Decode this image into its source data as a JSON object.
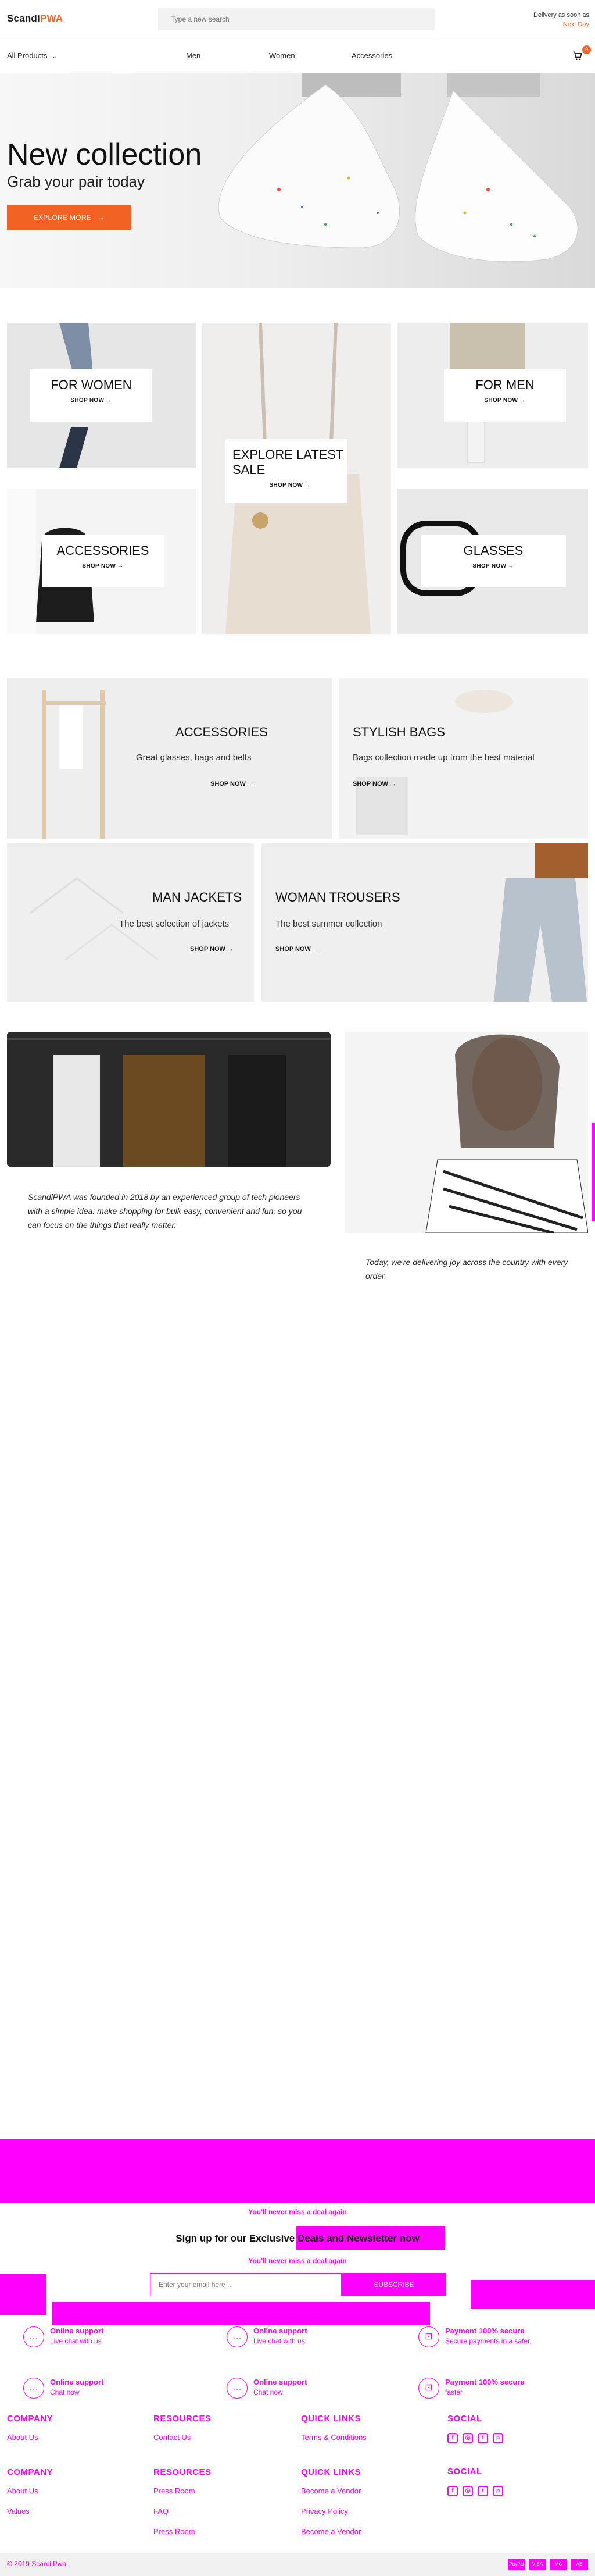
{
  "header": {
    "logo_part1": "Scandi",
    "logo_part2": "PWA",
    "search_placeholder": "Type a new search",
    "delivery_line1": "Delivery as soon as",
    "delivery_line2": "Next Day"
  },
  "nav": {
    "all_products": "All Products",
    "links": [
      "Men",
      "Women",
      "Accessories"
    ],
    "cart_count": "0"
  },
  "hero": {
    "title": "New collection",
    "subtitle": "Grab your pair today",
    "button": "EXPLORE MORE"
  },
  "categories": {
    "women": {
      "title": "FOR WOMEN",
      "link": "SHOP NOW →"
    },
    "sale": {
      "title": "EXPLORE LATEST SALE",
      "link": "SHOP NOW →"
    },
    "men": {
      "title": "FOR MEN",
      "link": "SHOP NOW →"
    },
    "accessories": {
      "title": "ACCESSORIES",
      "link": "SHOP NOW →"
    },
    "glasses": {
      "title": "GLASSES",
      "link": "SHOP NOW →"
    }
  },
  "banners": {
    "accessories": {
      "title": "ACCESSORIES",
      "sub": "Great glasses, bags and belts",
      "link": "SHOP NOW →"
    },
    "bags": {
      "title": "STYLISH BAGS",
      "sub": "Bags collection made up from the best material",
      "link": "SHOP NOW →"
    },
    "jackets": {
      "title": "MAN JACKETS",
      "sub": "The best selection of jackets",
      "link": "SHOP NOW →"
    },
    "trousers": {
      "title": "WOMAN TROUSERS",
      "sub": "The best summer collection",
      "link": "SHOP NOW →"
    }
  },
  "about": {
    "text1": "ScandiPWA was founded in 2018 by an experienced group of tech pioneers with a simple idea: make shopping for bulk easy, convenient and fun, so you can focus on the things that really matter.",
    "text2": "Today, we're delivering joy across the country with every order."
  },
  "newsletter": {
    "title": "Sign up for our Exclusive Deals and Newsletter now",
    "sub": "You'll never miss a deal again",
    "placeholder": "Enter your email here ...",
    "button": "SUBSCRIBE"
  },
  "features": [
    {
      "title": "Online support",
      "sub": "Live chat with us",
      "sub2": "Chat now"
    },
    {
      "title": "Online support",
      "sub": "Live chat with us",
      "sub2": "Chat now"
    },
    {
      "title": "Payment 100% secure",
      "sub": "Secure payments in a safer,",
      "sub2": "faster"
    }
  ],
  "footer": {
    "company": {
      "heading": "COMPANY",
      "links": [
        "About Us",
        "Values"
      ]
    },
    "resources": {
      "heading": "RESOURCES",
      "links": [
        "Contact Us",
        "FAQ",
        "Press Room"
      ]
    },
    "quicklinks": {
      "heading": "QUICK LINKS",
      "links": [
        "Terms & Conditions",
        "Privacy Policy",
        "Become a Vendor"
      ]
    },
    "social": {
      "heading": "SOCIAL"
    }
  },
  "bottom": {
    "copyright": "© 2019 ScandiPwa",
    "payments": [
      "PayPal",
      "VISA",
      "MC",
      "AE"
    ]
  },
  "colors": {
    "accent": "#f26323",
    "overlay": "#ff00ff"
  }
}
